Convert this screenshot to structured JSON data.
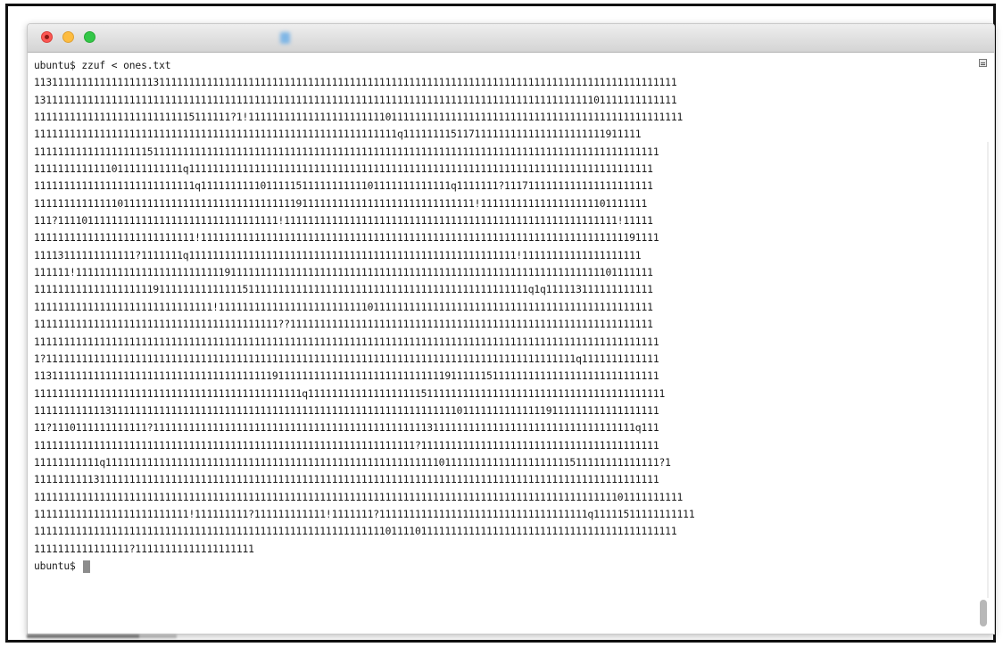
{
  "window": {
    "title": ""
  },
  "terminal": {
    "command_line": "ubuntu$ zzuf < ones.txt",
    "output_lines": [
      "113111111111111111113111111111111111111111111111111111111111111111111111111111111111111111111111111111111111",
      "131111111111111111111111111111111111111111111111111111111111111111111111111111111111111111111101111111111111",
      "111111111111111111111111115111111?1!1111111111111111111111101111111111111111111111111111111111111111111111111",
      "1111111111111111111111111111111111111111111111111111111111111q1111111151171111111111111111111111911111",
      "111111111111111111151111111111111111111111111111111111111111111111111111111111111111111111111111111111111",
      "1111111111111011111111111q111111111111111111111111111111111111111111111111111111111111111111111111111111",
      "111111111111111111111111111q111111111101111151111111111101111111111111q1111111?1117111111111111111111111",
      "11111111111111011111111111111111111111111111911111111111111111111111111111!1111111111111111111101111111",
      "111?1111011111111111111111111111111111111!11111111111111111111111111111111111111111111111111111111!11111",
      "111111111111111111111111111!11111111111111111111111111111111111111111111111111111111111111111111111191111",
      "11113111111111111?1111111q1111111111111111111111111111111111111111111111111111111!11111111111111111111",
      "111111!1111111111111111111111111911111111111111111111111111111111111111111111111111111111111111101111111",
      "11111111111111111111911111111111111511111111111111111111111111111111111111111111111q1q111113111111111111",
      "111111111111111111111111111111!1111111111111111111111111011111111111111111111111111111111111111111111111",
      "11111111111111111111111111111111111111111??1111111111111111111111111111111111111111111111111111111111111",
      "111111111111111111111111111111111111111111111111111111111111111111111111111111111111111111111111111111111",
      "1?11111111111111111111111111111111111111111111111111111111111111111111111111111111111111111q1111111111111",
      "113111111111111111111111111111111111111191111111111111111111111111111911111151111111111111111111111111111",
      "111111111111111111111111111111111111111111111q111111111111111111151111111111111111111111111111111111111111",
      "111111111111311111111111111111111111111111111111111111111111111111111110111111111111119111111111111111111",
      "11?1110111111111111?111111111111111111111111111111111111111111111131111111111111111111111111111111111q111",
      "1111111111111111111111111111111111111111111111111111111111111111?1111111111111111111111111111111111111111",
      "11111111111q111111111111111111111111111111111111111111111111111111110111111111111111111111511111111111111?1",
      "111111111131111111111111111111111111111111111111111111111111111111111111111111111111111111111111111111111",
      "1111111111111111111111111111111111111111111111111111111111111111111111111111111111111111111111111101111111111",
      "11111111111111111111111111!111111111?111111111111!1111111?11111111111111111111111111111111111q11111511111111111",
      "111111111111111111111111111111111111111111111111111111111110111101111111111111111111111111111111111111111111",
      "1111111111111111?11111111111111111111"
    ],
    "prompt_line": "ubuntu$ "
  }
}
